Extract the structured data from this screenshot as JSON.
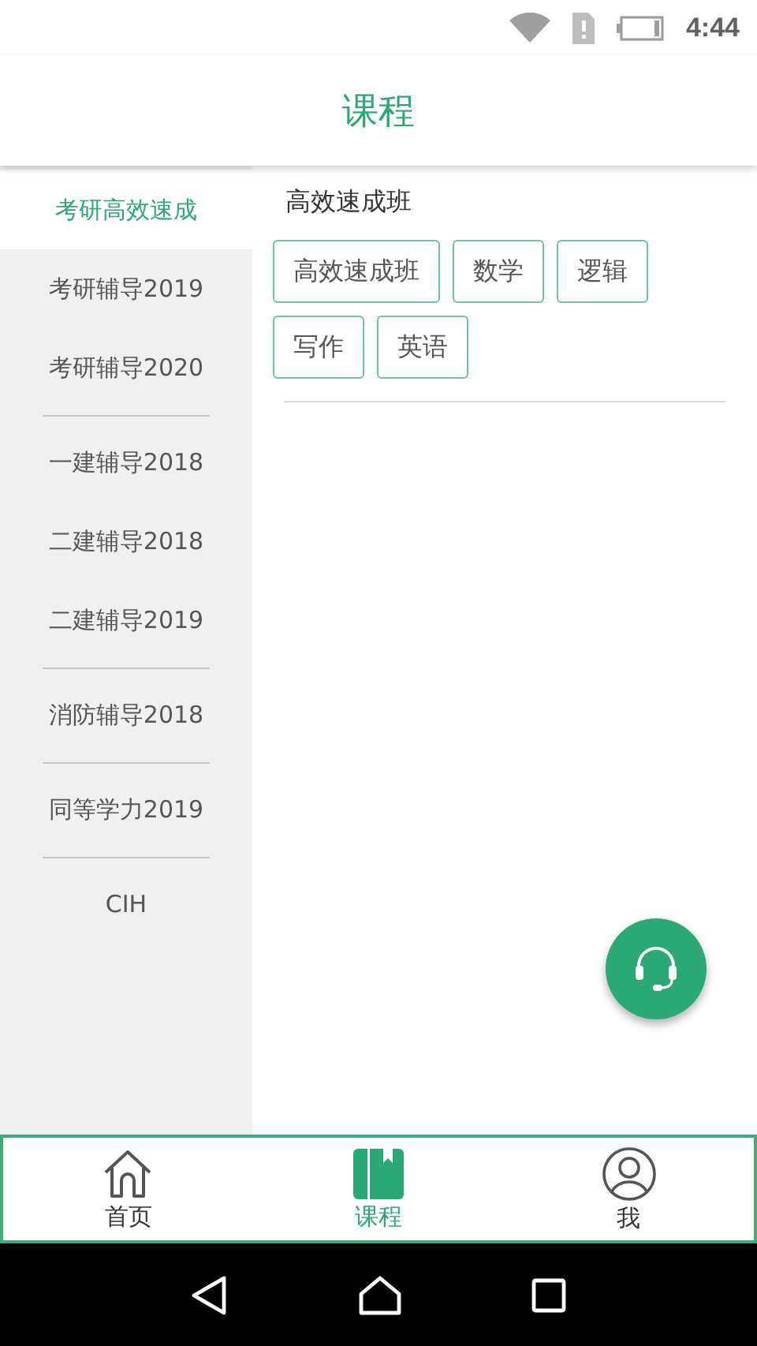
{
  "status_bar": {
    "time": "4:44"
  },
  "header": {
    "title": "课程"
  },
  "sidebar": {
    "groups": [
      [
        {
          "label": "考研高效速成",
          "selected": true
        },
        {
          "label": "考研辅导2019",
          "selected": false
        },
        {
          "label": "考研辅导2020",
          "selected": false
        }
      ],
      [
        {
          "label": "一建辅导2018",
          "selected": false
        },
        {
          "label": "二建辅导2018",
          "selected": false
        },
        {
          "label": "二建辅导2019",
          "selected": false
        }
      ],
      [
        {
          "label": "消防辅导2018",
          "selected": false
        }
      ],
      [
        {
          "label": "同等学力2019",
          "selected": false
        }
      ],
      [
        {
          "label": "CIH",
          "selected": false
        }
      ]
    ]
  },
  "content": {
    "heading": "高效速成班",
    "tags": [
      "高效速成班",
      "数学",
      "逻辑",
      "写作",
      "英语"
    ]
  },
  "bottom_nav": [
    {
      "label": "首页",
      "kind": "home",
      "selected": false
    },
    {
      "label": "课程",
      "kind": "book",
      "selected": true
    },
    {
      "label": "我",
      "kind": "profile",
      "selected": false
    }
  ]
}
